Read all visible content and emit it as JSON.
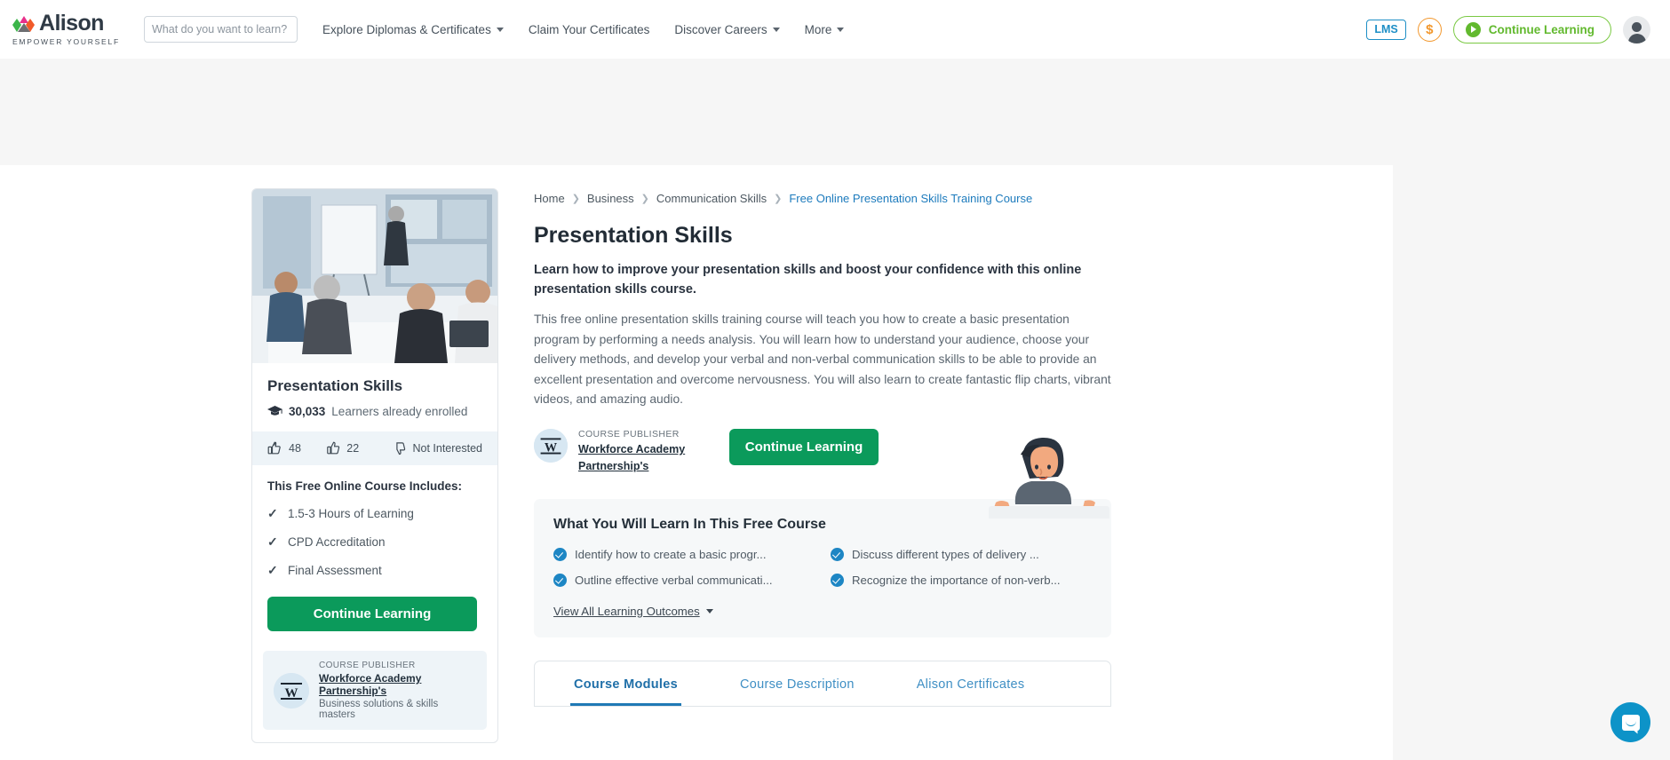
{
  "header": {
    "logo_word": "Alison",
    "logo_tagline": "EMPOWER YOURSELF",
    "search_placeholder": "What do you want to learn?",
    "search_value": "",
    "search_icon": "search-icon",
    "nav": [
      {
        "label": "Explore Diplomas & Certificates",
        "has_caret": true
      },
      {
        "label": "Claim Your Certificates",
        "has_caret": false
      },
      {
        "label": "Discover Careers",
        "has_caret": true
      },
      {
        "label": "More",
        "has_caret": true
      }
    ],
    "lms_badge": "LMS",
    "coin_symbol": "$",
    "continue_label": "Continue Learning",
    "accent_blue": "#1e8fc6",
    "accent_orange": "#f2972c",
    "accent_green": "#62b92e"
  },
  "sidebar": {
    "course_title": "Presentation Skills",
    "enrolled_count": "30,033",
    "enrolled_text": "Learners already enrolled",
    "enrolled_icon": "graduation-cap-icon",
    "reactions": {
      "likes": "48",
      "likes_alt": "22",
      "not_interested": "Not Interested"
    },
    "includes_title": "This Free Online Course Includes:",
    "includes": [
      "1.5-3 Hours of Learning",
      "CPD Accreditation",
      "Final Assessment"
    ],
    "cta_label": "Continue Learning",
    "publisher": {
      "kicker": "COURSE PUBLISHER",
      "name": "Workforce Academy Partnership's",
      "description": "Business solutions & skills masters",
      "logo_letter": "W"
    }
  },
  "main": {
    "breadcrumb": [
      {
        "label": "Home",
        "active": false
      },
      {
        "label": "Business",
        "active": false
      },
      {
        "label": "Communication Skills",
        "active": false
      },
      {
        "label": "Free Online Presentation Skills Training Course",
        "active": true
      }
    ],
    "title": "Presentation Skills",
    "lede": "Learn how to improve your presentation skills and boost your confidence with this online presentation skills course.",
    "description": "This free online presentation skills training course will teach you how to create a basic presentation program by performing a needs analysis. You will learn how to understand your audience, choose your delivery methods, and develop your verbal and non-verbal communication skills to be able to provide an excellent presentation and overcome nervousness. You will also learn to create fantastic flip charts, vibrant videos, and amazing audio.",
    "publisher": {
      "kicker": "COURSE PUBLISHER",
      "name": "Workforce Academy Partnership's",
      "logo_letter": "W"
    },
    "cta_label": "Continue Learning",
    "learn_panel": {
      "title": "What You Will Learn In This Free Course",
      "outcomes": [
        "Identify how to create a basic progr...",
        "Discuss different types of delivery ...",
        "Outline effective verbal communicati...",
        "Recognize the importance of non-verb..."
      ],
      "view_all_label": "View All Learning Outcomes"
    },
    "tabs": [
      {
        "label": "Course  Modules",
        "active": true
      },
      {
        "label": "Course  Description",
        "active": false
      },
      {
        "label": "Alison  Certificates",
        "active": false
      }
    ]
  },
  "chat": {
    "icon": "chat-bubble-icon"
  }
}
